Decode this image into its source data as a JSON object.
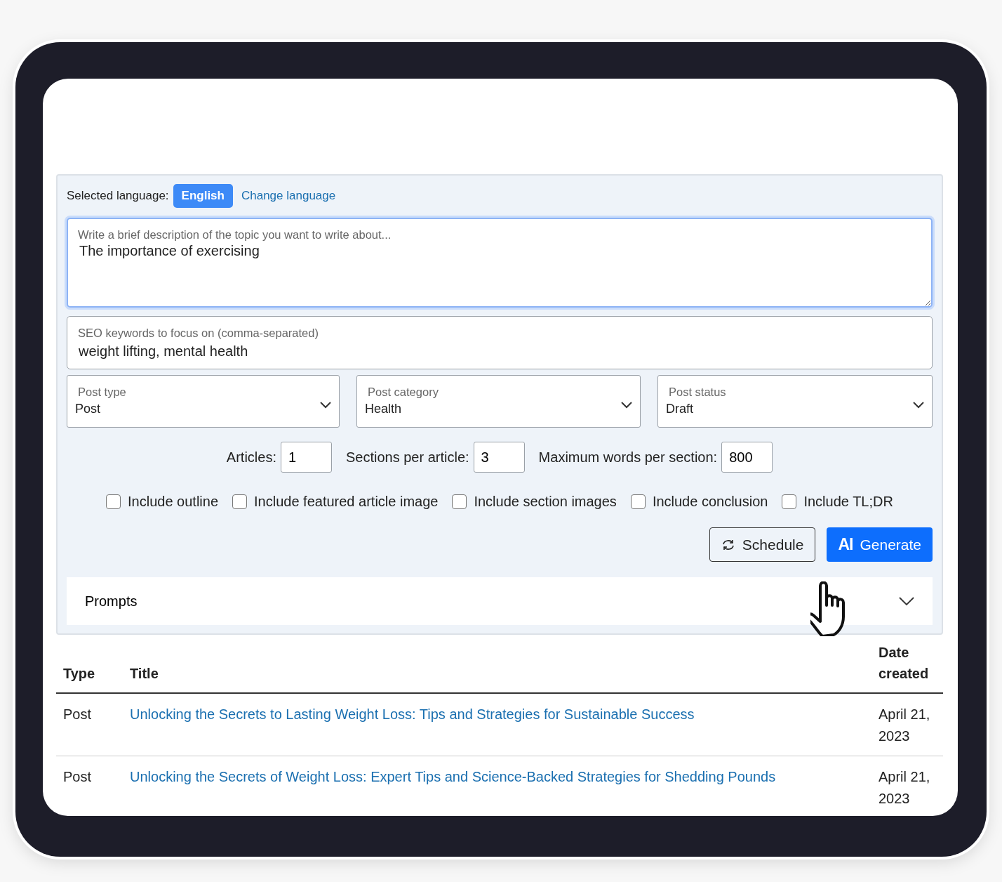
{
  "language": {
    "label": "Selected language:",
    "badge": "English",
    "change_link": "Change language"
  },
  "topic": {
    "label": "Write a brief description of the topic you want to write about...",
    "value": "The importance of exercising",
    "focused": true
  },
  "keywords": {
    "label": "SEO keywords to focus on (comma-separated)",
    "value": "weight lifting, mental health"
  },
  "selects": [
    {
      "label": "Post type",
      "value": "Post"
    },
    {
      "label": "Post category",
      "value": "Health"
    },
    {
      "label": "Post status",
      "value": "Draft"
    }
  ],
  "numbers": [
    {
      "label": "Articles:",
      "value": "1"
    },
    {
      "label": "Sections per article:",
      "value": "3"
    },
    {
      "label": "Maximum words per section:",
      "value": "800"
    }
  ],
  "options": [
    {
      "label": "Include outline",
      "checked": false
    },
    {
      "label": "Include featured article image",
      "checked": false
    },
    {
      "label": "Include section images",
      "checked": false
    },
    {
      "label": "Include conclusion",
      "checked": false
    },
    {
      "label": "Include TL;DR",
      "checked": false
    }
  ],
  "buttons": [
    {
      "kind": "schedule",
      "label": "Schedule"
    },
    {
      "kind": "generate",
      "label": "Generate",
      "mark": "AI"
    }
  ],
  "prompts": {
    "label": "Prompts",
    "expanded": false
  },
  "table": {
    "columns": [
      "Type",
      "Title",
      "Date created"
    ],
    "rows": [
      {
        "type": "Post",
        "title": "Unlocking the Secrets to Lasting Weight Loss: Tips and Strategies for Sustainable Success",
        "date": "April 21, 2023"
      },
      {
        "type": "Post",
        "title": "Unlocking the Secrets of Weight Loss: Expert Tips and Science-Backed Strategies for Shedding Pounds",
        "date": "April 21, 2023"
      }
    ]
  }
}
